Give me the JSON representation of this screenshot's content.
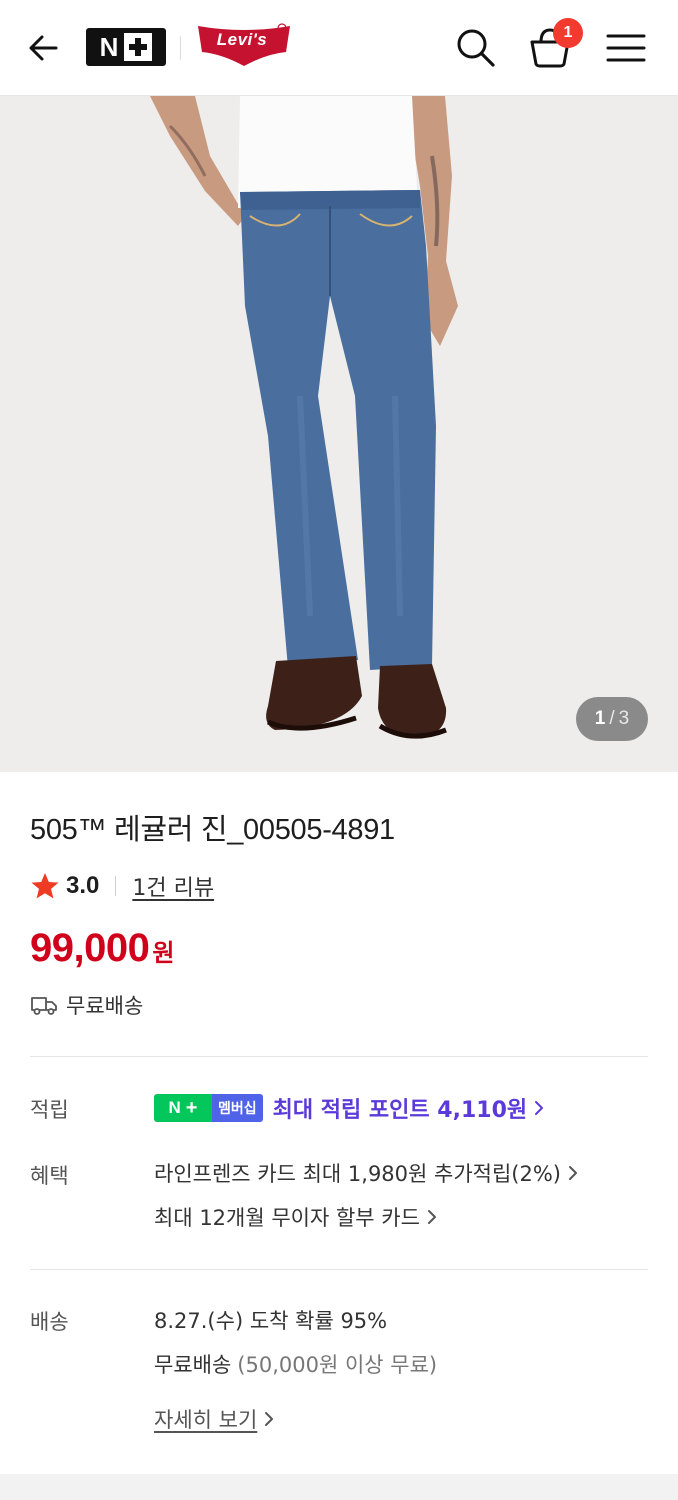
{
  "header": {
    "brand_badge_letter": "N",
    "partner_logo": "Levi's",
    "cart_count": "1",
    "icons": [
      "back-arrow-icon",
      "search-icon",
      "shopping-bag-icon",
      "menu-icon"
    ]
  },
  "gallery": {
    "current": "1",
    "separator": "/",
    "total": "3"
  },
  "product": {
    "title": "505™ 레귤러 진_00505-4891",
    "rating": "3.0",
    "review_link": "1건 리뷰",
    "price": "99,000",
    "currency": "원",
    "shipping_summary": "무료배송",
    "price_color": "#d0021b"
  },
  "points": {
    "label": "적립",
    "badge_letter": "N",
    "badge_text": "멤버십",
    "text": "최대 적립 포인트 4,110원",
    "color": "#5b3ad9"
  },
  "benefits": {
    "label": "혜택",
    "line1": "라인프렌즈 카드 최대 1,980원 추가적립(2%)",
    "line2": "최대 12개월 무이자 할부 카드"
  },
  "delivery": {
    "label": "배송",
    "eta": "8.27.(수) 도착 확률 95%",
    "free_label": "무료배송",
    "free_condition": "(50,000원 이상 무료)",
    "detail_link": "자세히 보기"
  }
}
